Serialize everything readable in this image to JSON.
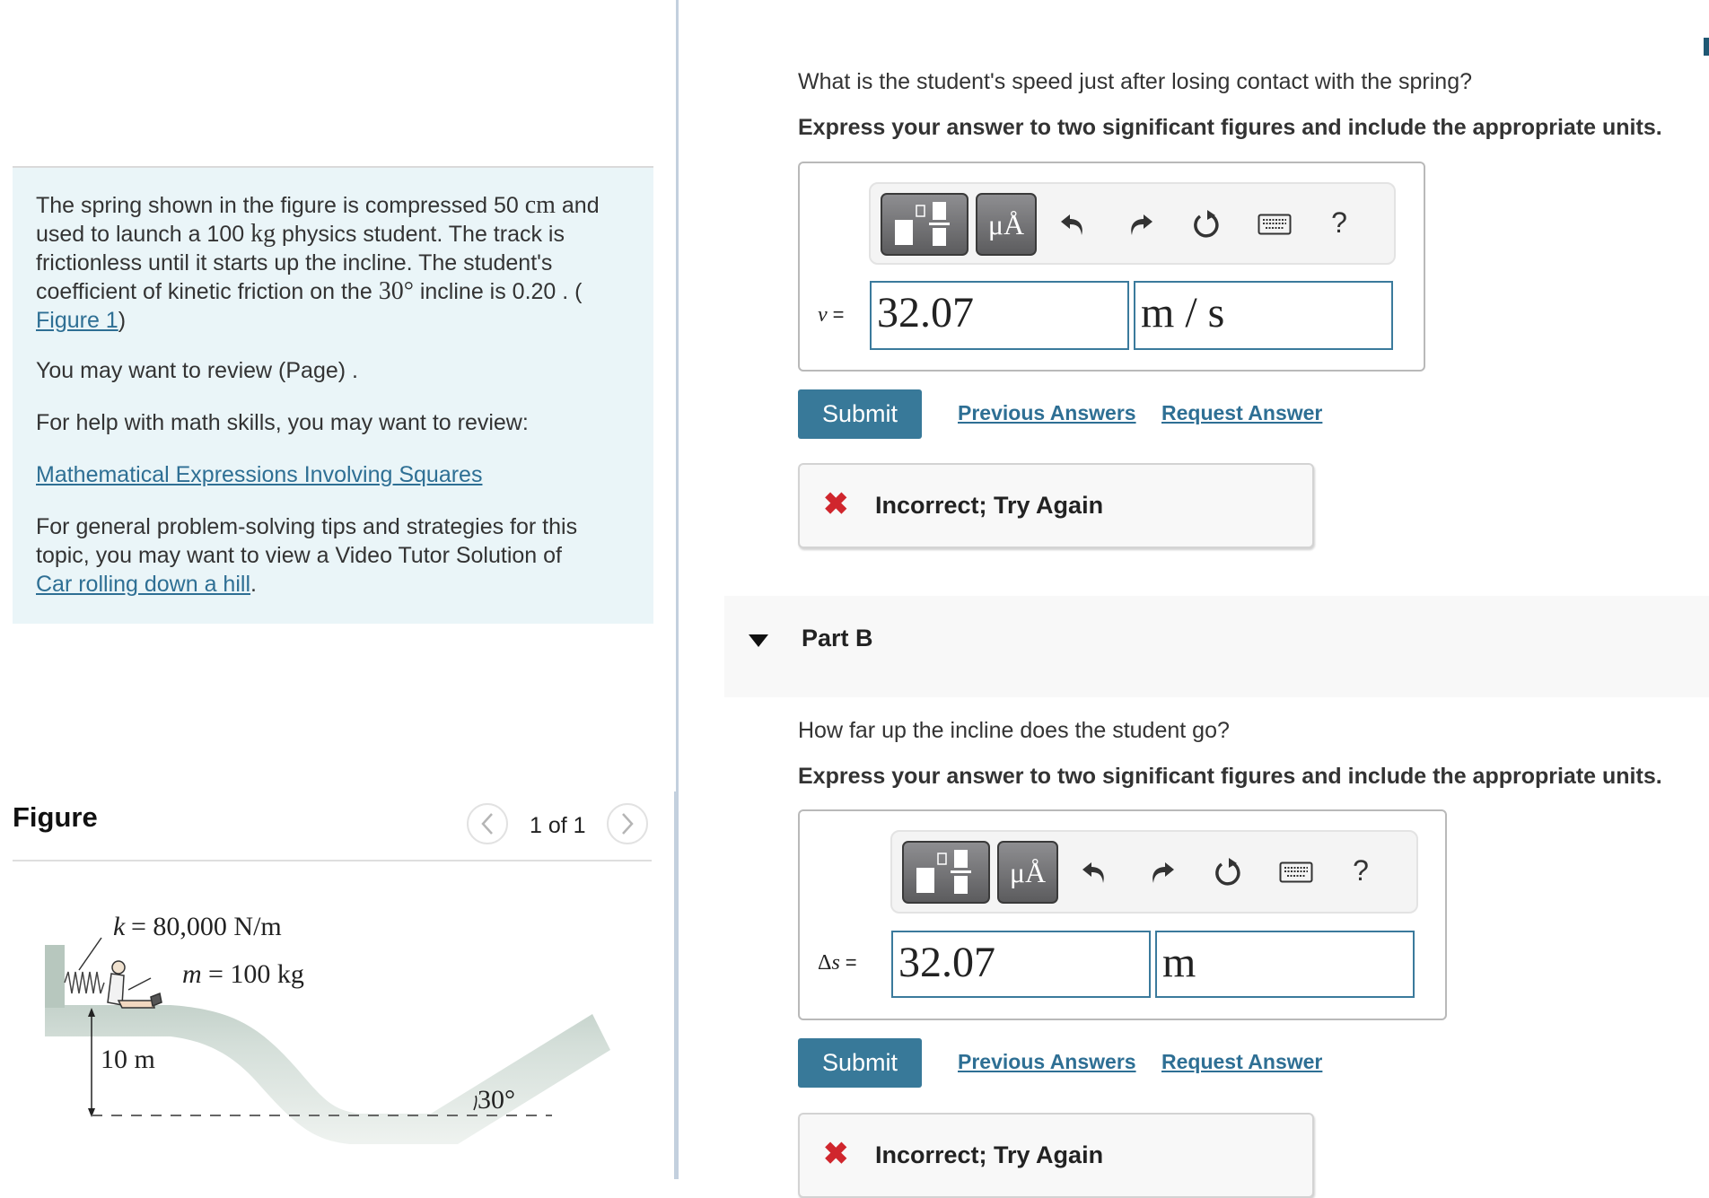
{
  "problem": {
    "intro_parts": [
      "The spring shown in the figure is compressed 50 ",
      "cm",
      " and used to launch a 100 ",
      "kg",
      " physics student. The track is frictionless until it starts up the incline. The student's coefficient of kinetic friction on the ",
      "30°",
      " incline is 0.20 . ("
    ],
    "figure_link": "Figure 1",
    "intro_close": ")",
    "review_text": "You may want to review (Page) .",
    "math_help_text": "For help with math skills, you may want to review:",
    "math_link": "Mathematical Expressions Involving Squares",
    "tips_text": "For general problem-solving tips and strategies for this topic, you may want to view a Video Tutor Solution of",
    "tips_link": "Car rolling down a hill",
    "tips_end": "."
  },
  "figure": {
    "title": "Figure",
    "pager": "1 of 1",
    "prev_icon": "chevron-left-icon",
    "next_icon": "chevron-right-icon",
    "labels": {
      "spring_constant": "k = 80,000 N/m",
      "k_var": "k",
      "k_val": "= 80,000 N/m",
      "m_var": "m",
      "m_val": "= 100 kg",
      "height": "10 m",
      "angle": "30°"
    }
  },
  "part_a": {
    "question": "What is the student's speed just after losing contact with the spring?",
    "instruction": "Express your answer to two significant figures and include the appropriate units.",
    "variable_label": "v =",
    "value": "32.07",
    "units": "m / s",
    "submit_label": "Submit",
    "previous_answers_label": "Previous Answers",
    "request_answer_label": "Request Answer",
    "feedback": "Incorrect; Try Again"
  },
  "part_b": {
    "header": "Part B",
    "question": "How far up the incline does the student go?",
    "instruction": "Express your answer to two significant figures and include the appropriate units.",
    "variable_label": "Δs =",
    "value": "32.07",
    "units": "m",
    "submit_label": "Submit",
    "previous_answers_label": "Previous Answers",
    "request_answer_label": "Request Answer",
    "feedback": "Incorrect; Try Again"
  },
  "toolbar": {
    "templates_icon": "templates-icon",
    "units_label": "μÅ",
    "undo_icon": "undo-icon",
    "redo_icon": "redo-icon",
    "reset_icon": "reset-icon",
    "keyboard_icon": "keyboard-icon",
    "help_label": "?"
  },
  "colors": {
    "accent": "#387999",
    "link": "#2e6f94",
    "error": "#d0262d",
    "info_bg": "#eaf5f8"
  }
}
